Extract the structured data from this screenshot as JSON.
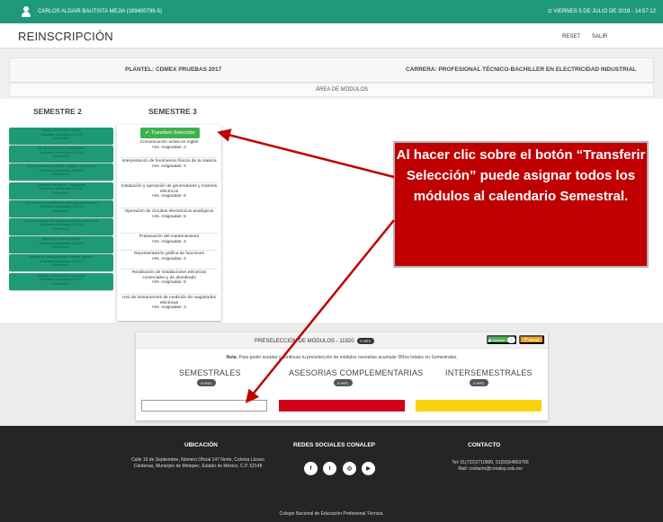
{
  "topbar": {
    "user_name": "CARLOS ALDAIR BAUTISTA MEJIA (169400799-5)",
    "clock": "⊙ VIERNES 5 DE JULIO DE 2019 - 14:57:12"
  },
  "header": {
    "title": "REINSCRIPCIÓN",
    "reset_label": "RESET",
    "salir_label": "SALIR"
  },
  "info": {
    "plantel": "PLANTEL: CDMEX PRUEBAS 2017",
    "carrera": "CARRERA: PROFESIONAL TÉCNICO-BACHILLER EN ELECTRICIDAD INDUSTRIAL",
    "area": "ÁREA DE MÓDULOS"
  },
  "semestre2": {
    "title": "SEMESTRE 2",
    "items": [
      {
        "name": "Manejo de técnicas escritas",
        "status": "Evaluación Acreditada 100.0%",
        "period": "Semestral 2"
      },
      {
        "name": "Identificación de la sostenibilidad",
        "status": "Evaluación Acreditada 100.0%",
        "period": "Semestral 2"
      },
      {
        "name": "Representación simbólica y angular del entorno",
        "status": "Evaluación Acreditada 100.0%",
        "period": "Semestral 2"
      },
      {
        "name": "Desarrollo de planes y diagramas",
        "status": "Evaluación Acreditada 100.0%",
        "period": "Semestral 2"
      },
      {
        "name": "Operación de herramientas eléctricas combinadas",
        "status": "Evaluación Acreditada 100.0%",
        "period": "Semestral 2"
      },
      {
        "name": "Comunicación en los ámbitos escolar y profesional",
        "status": "Evaluación Acreditada 100.0%",
        "period": "Semestral 2"
      },
      {
        "name": "Interacción inicial en inglés",
        "status": "Evaluación Acreditada 100.0%",
        "period": "Semestral 2"
      },
      {
        "name": "Manejo de aplicaciones por medios digitales",
        "status": "Evaluación Acreditada 100.0%",
        "period": "Semestral 2"
      },
      {
        "name": "Análisis de la materia y la energía",
        "status": "Evaluación Acreditada 100.0%",
        "period": "Semestral 2"
      }
    ]
  },
  "semestre3": {
    "title": "SEMESTRE 3",
    "transfer_label": "Transferir Selección",
    "items": [
      {
        "name": "Comunicación activa en inglés",
        "hours": "Hrs. Asignadas: 3"
      },
      {
        "name": "Interpretación de fenómenos físicos de la materia",
        "hours": "Hrs. Asignadas: 4"
      },
      {
        "name": "Instalación y operación de generadores y motores eléctricos",
        "hours": "Hrs. Asignadas: 6"
      },
      {
        "name": "Operación de circuitos electrónicos analógicos",
        "hours": "Hrs. Asignadas: 5"
      },
      {
        "name": "Preparación del mantenimiento",
        "hours": "Hrs. Asignadas: 4"
      },
      {
        "name": "Representación gráfica de funciones",
        "hours": "Hrs. Asignadas: 4"
      },
      {
        "name": "Realización de instalaciones eléctricas comerciales y de alumbrado",
        "hours": "Hrs. Asignadas: 5"
      },
      {
        "name": "Uso de instrumentos de medición de magnitudes eléctricas",
        "hours": "Hrs. Asignadas: 3"
      }
    ]
  },
  "callout": {
    "text": "Al hacer clic sobre el botón “Transferir Selección” puede asignar todos los módulos al calendario Semestral."
  },
  "preseleccion": {
    "title": "PRESELECCIÓN DE MÓDULOS - 11920",
    "title_badge": "0 HRS.",
    "aceptar_label": "Aceptar",
    "aceptar_badge": "0",
    "reset_label": "Reset",
    "nota_bold": "Nota:",
    "nota_text": "Para poder aceptar y continuar tu preselección de módulos necesitas acumular 35hrs totales en Semestrales.",
    "columns": [
      {
        "title": "SEMESTRALES",
        "badge": "0 HRS.",
        "color": "#ffffff"
      },
      {
        "title": "ASESORIAS COMPLEMENTARIAS",
        "badge": "0 HRS.",
        "color": "#d0021b"
      },
      {
        "title": "INTERSEMESTRALES",
        "badge": "0 HRS.",
        "color": "#f8d20a"
      }
    ]
  },
  "footer": {
    "ubicacion_title": "UBICACIÓN",
    "ubicacion_text": "Calle 16 de Septiembre, Número Oficial 147 Norte, Colonia Lázaro Cárdenas, Municipio de Metepec, Estado de México, C.P. 52148",
    "redes_title": "REDES SOCIALES CONALEP",
    "contacto_title": "CONTACTO",
    "contacto_tel": "Tel: 01(722)2710800, 01(55)54803766",
    "contacto_mail": "Mail: contacto@conalep.edu.mx",
    "bottom": "Colegio Nacional de Educación Profesional Técnica."
  },
  "colors": {
    "brand_green": "#1e9a7a",
    "button_green": "#3cb34a",
    "callout_red": "#c00000",
    "footer_dark": "#252525"
  }
}
